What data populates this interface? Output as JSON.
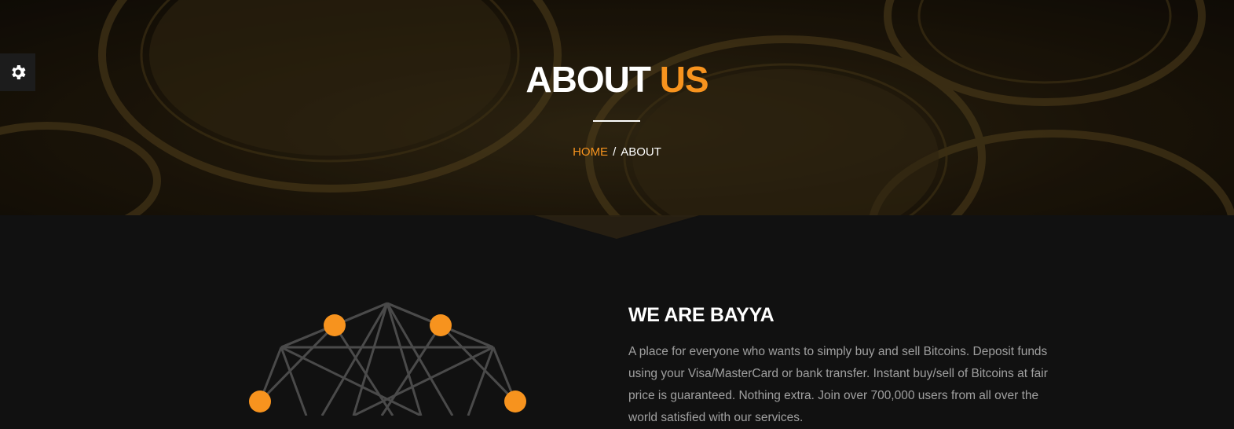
{
  "hero": {
    "title_main": "ABOUT",
    "title_accent": "US",
    "breadcrumb_home": "HOME",
    "breadcrumb_separator": "/",
    "breadcrumb_current": "ABOUT"
  },
  "settings": {
    "icon": "gear-icon"
  },
  "about": {
    "heading": "WE ARE BAYYA",
    "text": "A place for everyone who wants to simply buy and sell Bitcoins. Deposit funds using your Visa/MasterCard or bank transfer. Instant buy/sell of Bitcoins at fair price is guaranteed. Nothing extra. Join over 700,000 users from all over the world satisfied with our services."
  },
  "colors": {
    "accent": "#f7931e",
    "background": "#111111",
    "text_muted": "#a0a0a0",
    "network_node": "#f7931e",
    "network_line": "#4a4a4a"
  }
}
